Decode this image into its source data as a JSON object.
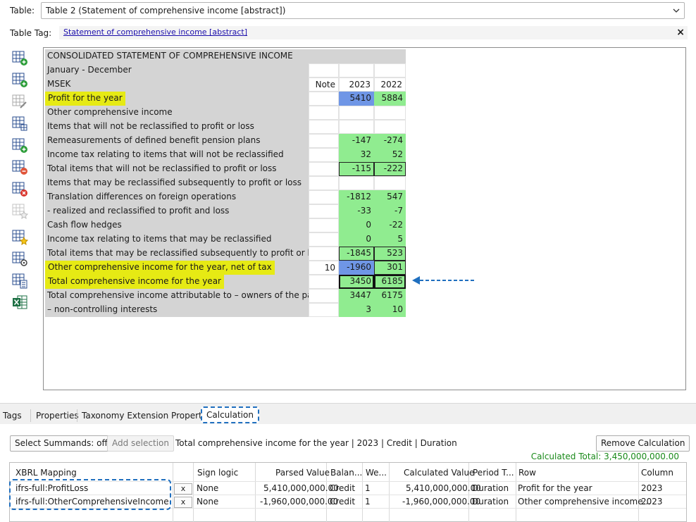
{
  "header": {
    "table_label": "Table:",
    "table_value": "Table 2 (Statement of comprehensive income [abstract])",
    "tag_label": "Table Tag:",
    "tag_value": "Statement of comprehensive income [abstract]",
    "close_glyph": "×"
  },
  "statement": {
    "rows": [
      {
        "label": "CONSOLIDATED STATEMENT OF COMPREHENSIVE INCOME",
        "note": null,
        "y1": null,
        "y2": null
      },
      {
        "label": "January - December",
        "note": "",
        "y1": "",
        "y2": ""
      },
      {
        "label": "MSEK",
        "note": "Note",
        "y1": "2023",
        "y2": "2022"
      },
      {
        "label": "Profit for the year",
        "note": "",
        "y1": "5410",
        "y2": "5884"
      },
      {
        "label": "Other comprehensive income",
        "note": "",
        "y1": "",
        "y2": ""
      },
      {
        "label": "Items that will not be reclassified to profit or loss",
        "note": "",
        "y1": "",
        "y2": ""
      },
      {
        "label": "Remeasurements of defined benefit pension plans",
        "note": "",
        "y1": "-147",
        "y2": "-274"
      },
      {
        "label": "Income tax relating to items that will not be reclassified",
        "note": "",
        "y1": "32",
        "y2": "52"
      },
      {
        "label": "Total items that will not be reclassified to profit or loss",
        "note": "",
        "y1": "-115",
        "y2": "-222"
      },
      {
        "label": "Items that may be reclassified subsequently to profit or loss",
        "note": "",
        "y1": "",
        "y2": ""
      },
      {
        "label": "Translation differences on foreign operations",
        "note": "",
        "y1": "-1812",
        "y2": "547"
      },
      {
        "label": "- realized and reclassified to profit and loss",
        "note": "",
        "y1": "-33",
        "y2": "-7"
      },
      {
        "label": "Cash flow hedges",
        "note": "",
        "y1": "0",
        "y2": "-22"
      },
      {
        "label": "Income tax relating to items that may be reclassified",
        "note": "",
        "y1": "0",
        "y2": "5"
      },
      {
        "label": "Total items that may be reclassified subsequently to profit or loss",
        "note": "",
        "y1": "-1845",
        "y2": "523"
      },
      {
        "label": "Other comprehensive income for the year, net of tax",
        "note": "10",
        "y1": "-1960",
        "y2": "301"
      },
      {
        "label": "Total comprehensive income for the year",
        "note": "",
        "y1": "3450",
        "y2": "6185"
      },
      {
        "label": "Total comprehensive income attributable to – owners of the parent",
        "note": "",
        "y1": "3447",
        "y2": "6175"
      },
      {
        "label": "– non-controlling interests",
        "note": "",
        "y1": "3",
        "y2": "10"
      }
    ]
  },
  "tabs": [
    "Tags",
    "Properties",
    "Taxonomy Extension Properties",
    "Calculation"
  ],
  "calculation": {
    "select_summands": "Select Summands: off",
    "add_selection": "Add selection",
    "info": "Total comprehensive income for the year | 2023 | Credit | Duration",
    "remove": "Remove Calculation",
    "calculated_total": "Calculated Total: 3,450,000,000.00",
    "columns": [
      "XBRL Mapping",
      "Sign logic",
      "Parsed Value",
      "Balan...",
      "We...",
      "Calculated Value",
      "Period T...",
      "Row",
      "Column"
    ],
    "rows": [
      {
        "mapping": "ifrs-full:ProfitLoss",
        "x": "x",
        "sign": "None",
        "parsed": "5,410,000,000.00",
        "balance": "Credit",
        "weight": "1",
        "calculated": "5,410,000,000.00",
        "period": "Duration",
        "row": "Profit for the year",
        "column": "2023"
      },
      {
        "mapping": "ifrs-full:OtherComprehensiveIncome",
        "x": "x",
        "sign": "None",
        "parsed": "-1,960,000,000.00",
        "balance": "Credit",
        "weight": "1",
        "calculated": "-1,960,000,000.00",
        "period": "Duration",
        "row": "Other comprehensive income...",
        "column": "2023"
      }
    ]
  },
  "icons": [
    "add-row-icon",
    "add-column-icon",
    "edit-table-icon",
    "table-grid-icon",
    "add-table-icon",
    "remove-row-icon",
    "delete-table-icon",
    "star-table-icon",
    "favorite-table-icon",
    "settings-table-icon",
    "calculate-icon",
    "excel-icon"
  ],
  "colors": {
    "highlight": "#e6ea14",
    "value_green": "#90ec90",
    "value_blue": "#6f96e6",
    "accent": "#1f6fbf",
    "total_green": "#1a8a1a"
  }
}
